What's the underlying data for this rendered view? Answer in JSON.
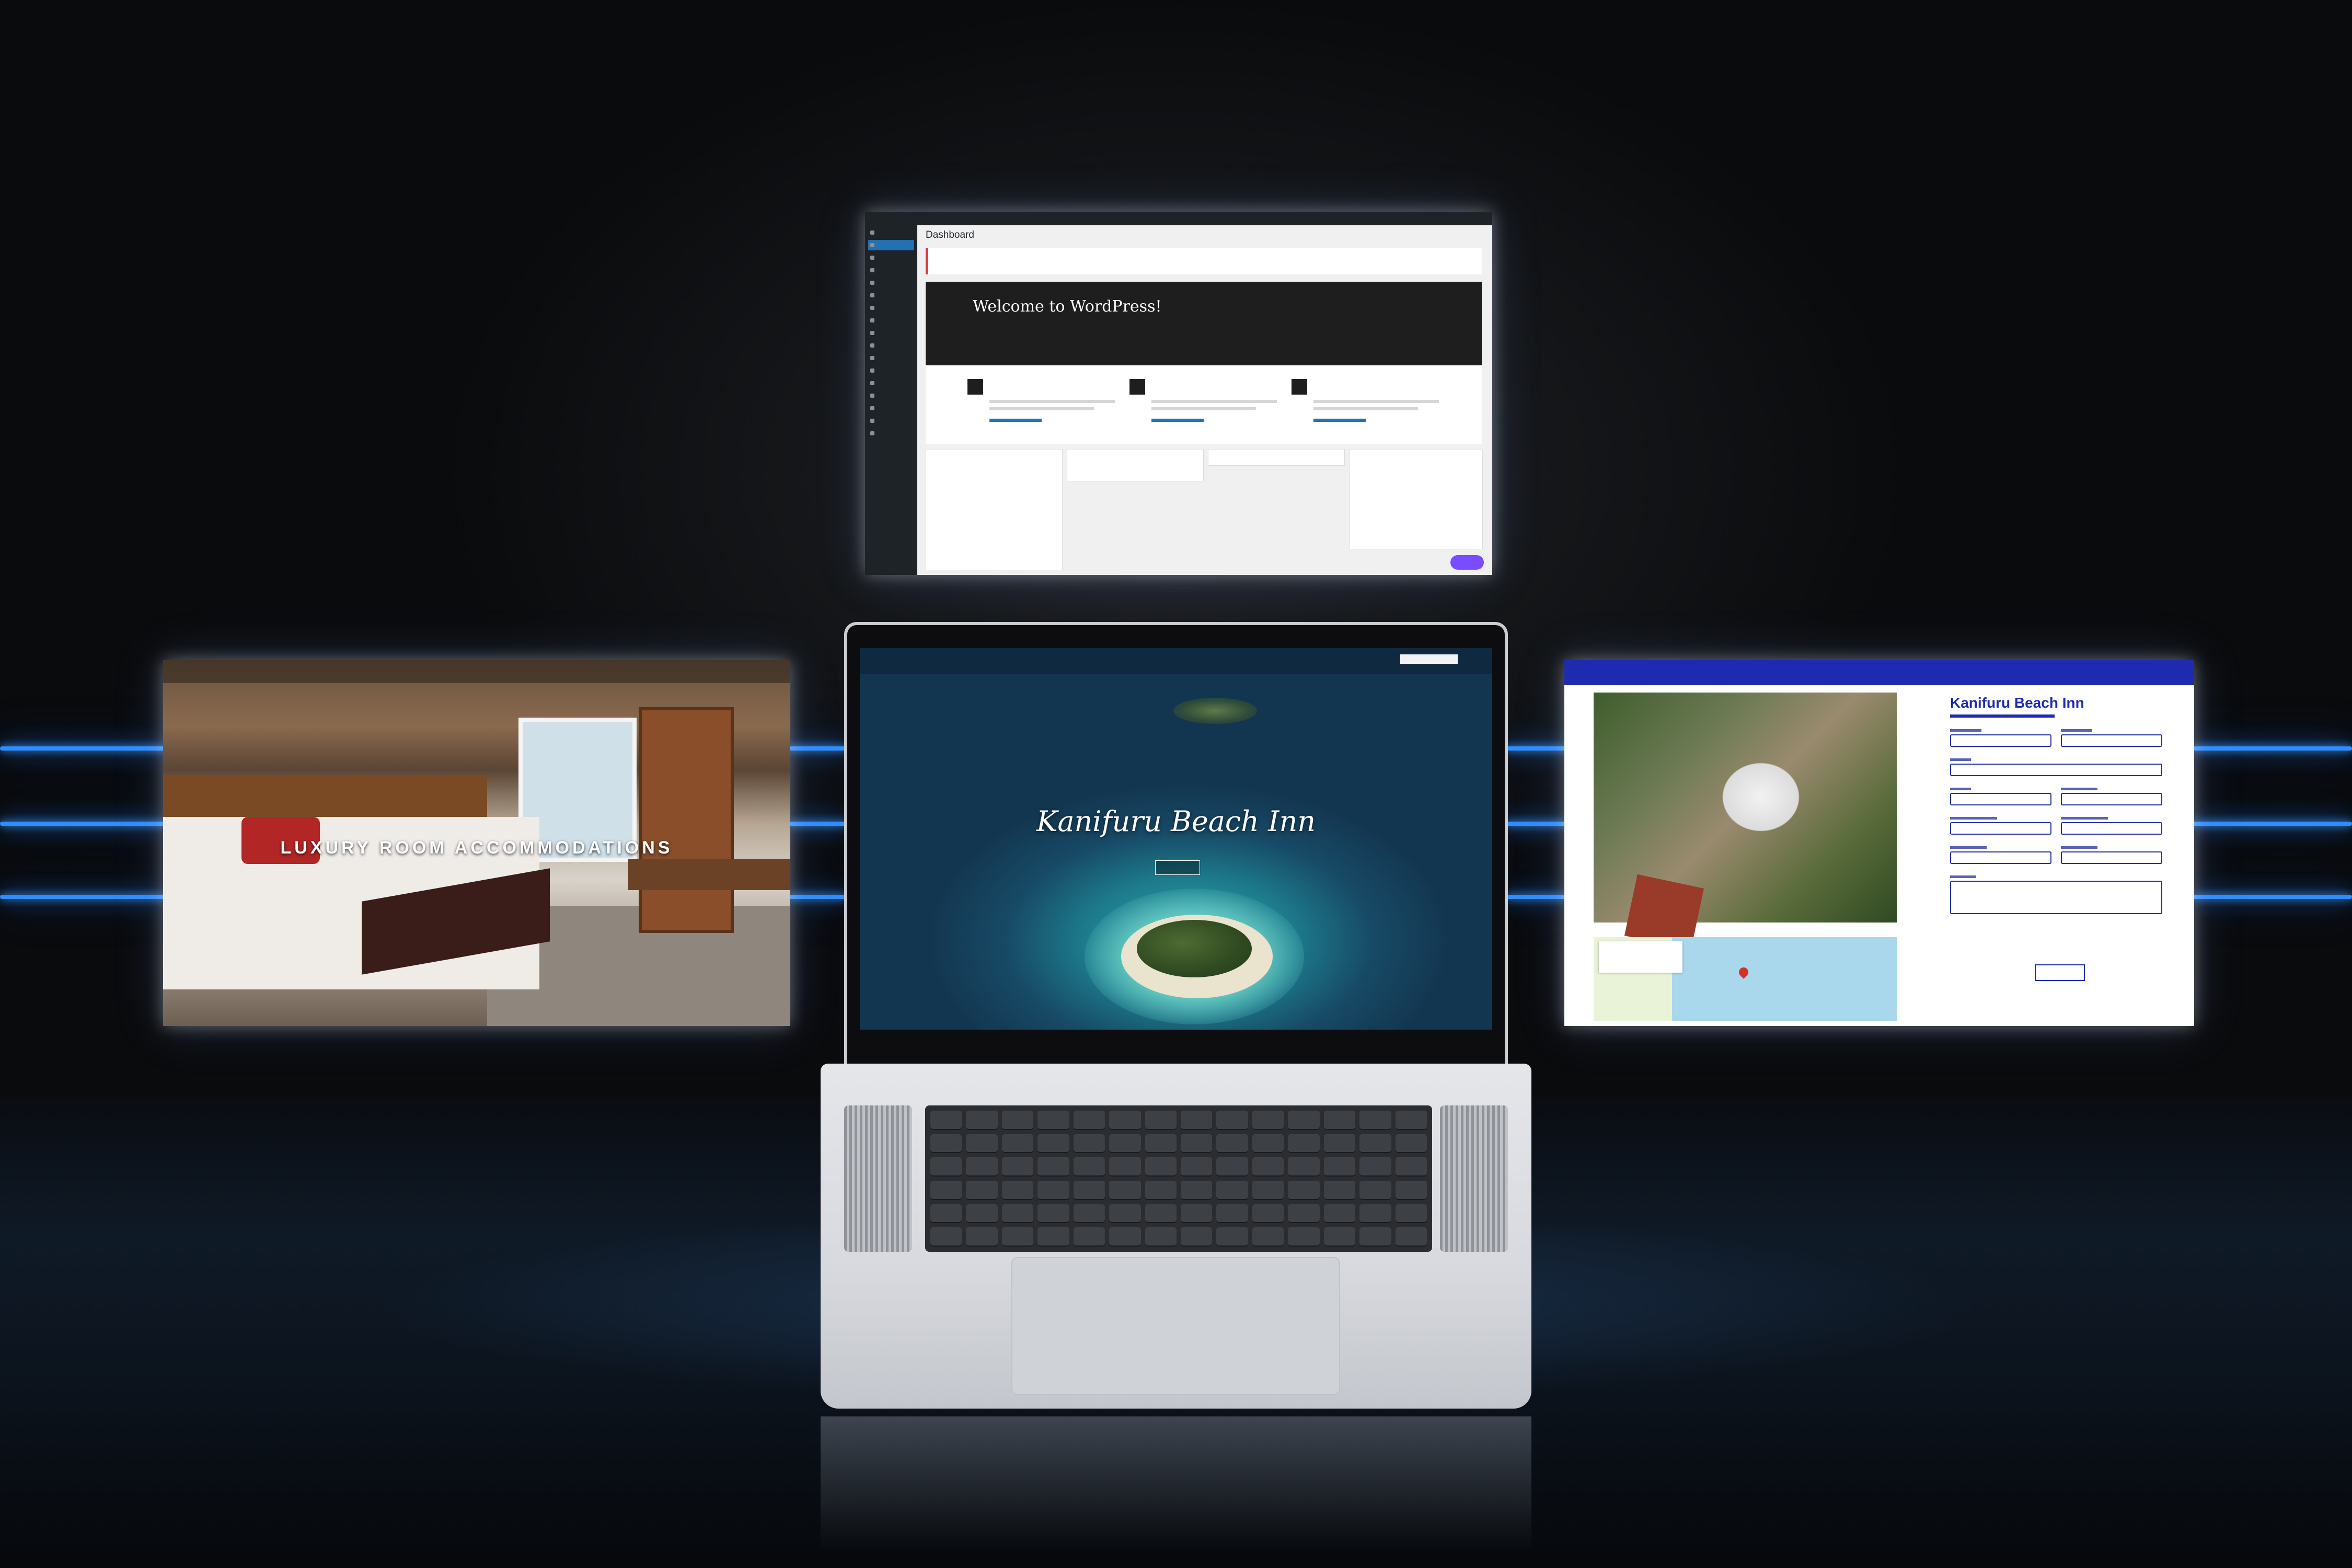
{
  "scene": {
    "colors": {
      "backdrop": "#16181b",
      "floor": "#0f1a27",
      "neon": "#2f8dff"
    }
  },
  "wp_dashboard": {
    "title": "Dashboard",
    "welcome_heading": "Welcome to WordPress!",
    "accent": "#2271b1"
  },
  "room_site": {
    "headline": "LUXURY ROOM ACCOMMODATIONS"
  },
  "laptop_site": {
    "hero_title": "Kanifuru Beach Inn",
    "colors": {
      "water": "#174a66",
      "reef": "#5ec2bd",
      "sand": "#eae3cd"
    }
  },
  "booking_site": {
    "title": "Kanifuru Beach Inn",
    "brand_color": "#1e2bb0"
  }
}
